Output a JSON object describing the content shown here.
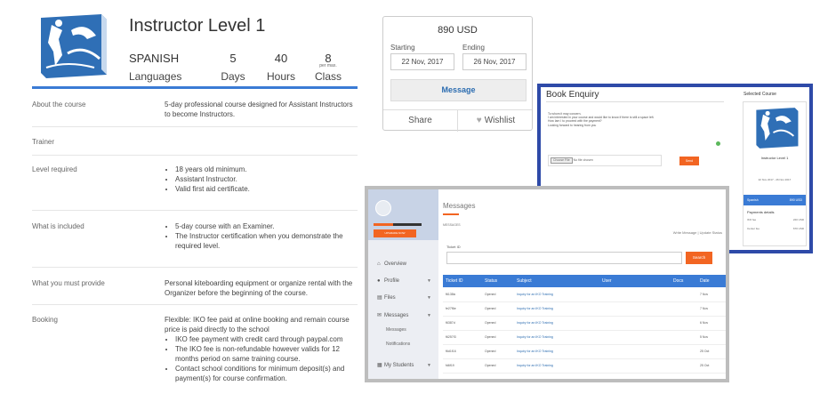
{
  "course": {
    "title": "Instructor Level 1",
    "stats": [
      {
        "value": "SPANISH",
        "label": "Languages"
      },
      {
        "value": "5",
        "label": "Days"
      },
      {
        "value": "40",
        "label": "Hours"
      },
      {
        "value": "8",
        "sub": "per max.",
        "label": "Class"
      }
    ],
    "colors": {
      "accent": "#3a7bd5",
      "orange": "#f26522"
    }
  },
  "details": {
    "about": {
      "label": "About the course",
      "text": "5-day professional course designed for Assistant Instructors to become Instructors."
    },
    "trainer": {
      "label": "Trainer"
    },
    "level": {
      "label": "Level required",
      "items": [
        "18 years old minimum.",
        "Assistant Instructor.",
        "Valid first aid certificate."
      ]
    },
    "included": {
      "label": "What is included",
      "items": [
        "5-day course with an Examiner.",
        "The Instructor certification when you demonstrate the required level."
      ]
    },
    "provide": {
      "label": "What you must provide",
      "text": "Personal kiteboarding equipment or organize rental with the Organizer before the beginning of the course."
    },
    "booking": {
      "label": "Booking",
      "intro": "Flexible: IKO fee paid at online booking and remain course price is paid directly to the school",
      "items": [
        "IKO fee payment with credit card through paypal.com",
        "The IKO fee is non-refundable however valids for 12 months period on same training course.",
        "Contact school conditions for minimum deposit(s) and payment(s) for course confirmation."
      ]
    }
  },
  "price_card": {
    "price": "890 USD",
    "starting_label": "Starting",
    "starting_value": "22 Nov, 2017",
    "ending_label": "Ending",
    "ending_value": "26 Nov, 2017",
    "message_label": "Message",
    "share_label": "Share",
    "wishlist_label": "Wishlist"
  },
  "enquiry": {
    "title": "Book Enquiry",
    "message_lines": [
      "To whom it may concern,",
      "I am interested in your course and would like to know if there is still a space left.",
      "How Iam I to proceed with the payment?",
      "Looking forward to hearing from you"
    ],
    "file_button": "Choose File",
    "file_status": "No file chosen",
    "send_label": "Send",
    "selected": {
      "heading": "Selected Course",
      "name": "Instructor Level 1",
      "dates": "22 Nov 2017 - 26 Nov 2017",
      "language": "Spanish",
      "price": "890 USD",
      "payments_title": "Payments details",
      "rows": [
        {
          "label": "IKO fee",
          "value": "220 USD"
        },
        {
          "label": "Center fee",
          "value": "670 USD"
        }
      ]
    }
  },
  "messages": {
    "title": "Messages",
    "upgrade_label": "UPGRADE NOW",
    "messages_label": "MESSAGES",
    "links": "Write Message | Update Status",
    "search_label": "Ticket ID",
    "search_button": "Search",
    "nav": [
      {
        "icon": "home-icon",
        "glyph": "⌂",
        "label": "Overview"
      },
      {
        "icon": "user-icon",
        "glyph": "●",
        "label": "Profile"
      },
      {
        "icon": "file-icon",
        "glyph": "▤",
        "label": "Files"
      },
      {
        "icon": "mail-icon",
        "glyph": "✉",
        "label": "Messages"
      },
      {
        "icon": "students-icon",
        "glyph": "▦",
        "label": "My Students"
      }
    ],
    "nav_sub": [
      "Messages",
      "Notifications"
    ],
    "columns": [
      "Ticket ID",
      "Status",
      "Subject",
      "User",
      "Docs",
      "Date"
    ],
    "rows": [
      {
        "id": "f6138ic",
        "status": "Opened",
        "subject": "Inquiry for an IKO Training",
        "date": "7 Nov"
      },
      {
        "id": "fe27f6e",
        "status": "Opened",
        "subject": "Inquiry for an IKO Training",
        "date": "7 Nov"
      },
      {
        "id": "f6387d",
        "status": "Opened",
        "subject": "Inquiry for an IKO Training",
        "date": "6 Nov"
      },
      {
        "id": "f6257f3",
        "status": "Opened",
        "subject": "Inquiry for an IKO Training",
        "date": "5 Nov"
      },
      {
        "id": "f6d1f16",
        "status": "Opened",
        "subject": "Inquiry for an IKO Training",
        "date": "25 Oct"
      },
      {
        "id": "fd6f19",
        "status": "Opened",
        "subject": "Inquiry for an IKO Training",
        "date": "25 Oct"
      }
    ]
  }
}
